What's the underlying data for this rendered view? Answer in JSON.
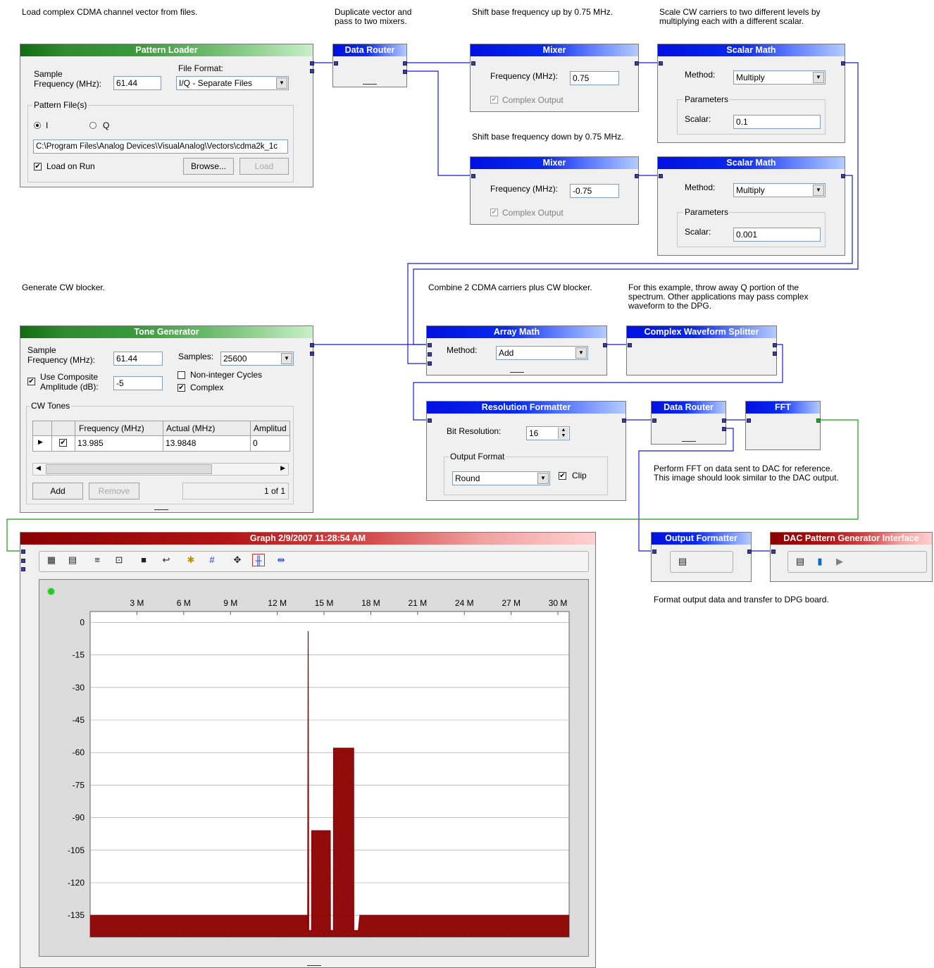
{
  "notes": {
    "load": "Load complex CDMA channel vector from files.",
    "duplicate": "Duplicate vector and\npass to two mixers.",
    "shift_up": "Shift base frequency up by 0.75 MHz.",
    "scale": "Scale CW carriers to two different levels by\nmultiplying each with a different scalar.",
    "shift_down": "Shift base frequency down by 0.75 MHz.",
    "generate_cw": "Generate CW blocker.",
    "combine": "Combine 2 CDMA carriers plus CW blocker.",
    "throw_away": "For this example, throw away Q portion of the\nspectrum.  Other applications may pass complex\nwaveform to the DPG.",
    "perform_fft": "Perform FFT on data sent to DAC for reference.\nThis image should look similar to the DAC output.",
    "format_output": "Format output data and transfer to DPG board."
  },
  "pattern_loader": {
    "title": "Pattern Loader",
    "sample_freq_label": "Sample\nFrequency (MHz):",
    "sample_freq_value": "61.44",
    "file_format_label": "File Format:",
    "file_format_value": "I/Q - Separate Files",
    "pattern_files_label": "Pattern File(s)",
    "radio_i": "I",
    "radio_q": "Q",
    "path": "C:\\Program Files\\Analog Devices\\VisualAnalog\\Vectors\\cdma2k_1c",
    "load_on_run": "Load on Run",
    "browse": "Browse...",
    "load": "Load"
  },
  "data_router_1": {
    "title": "Data Router"
  },
  "mixer_1": {
    "title": "Mixer",
    "freq_label": "Frequency (MHz):",
    "freq_value": "0.75",
    "complex_output": "Complex Output"
  },
  "mixer_2": {
    "title": "Mixer",
    "freq_label": "Frequency (MHz):",
    "freq_value": "-0.75",
    "complex_output": "Complex Output"
  },
  "scalar_math_1": {
    "title": "Scalar Math",
    "method_label": "Method:",
    "method_value": "Multiply",
    "params_label": "Parameters",
    "scalar_label": "Scalar:",
    "scalar_value": "0.1"
  },
  "scalar_math_2": {
    "title": "Scalar Math",
    "method_label": "Method:",
    "method_value": "Multiply",
    "params_label": "Parameters",
    "scalar_label": "Scalar:",
    "scalar_value": "0.001"
  },
  "tone_generator": {
    "title": "Tone Generator",
    "sample_freq_label": "Sample\nFrequency (MHz):",
    "sample_freq_value": "61.44",
    "samples_label": "Samples:",
    "samples_value": "25600",
    "use_composite": "Use Composite\nAmplitude (dB):",
    "amplitude_value": "-5",
    "non_integer": "Non-integer Cycles",
    "complex": "Complex",
    "cw_tones_label": "CW Tones",
    "columns": [
      "Frequency (MHz)",
      "Actual (MHz)",
      "Amplitud"
    ],
    "row": [
      "13.985",
      "13.9848",
      "0"
    ],
    "add": "Add",
    "remove": "Remove",
    "page": "1 of 1"
  },
  "array_math": {
    "title": "Array Math",
    "method_label": "Method:",
    "method_value": "Add"
  },
  "splitter": {
    "title": "Complex Waveform Splitter"
  },
  "resolution_formatter": {
    "title": "Resolution Formatter",
    "bit_label": "Bit Resolution:",
    "bit_value": "16",
    "output_format_label": "Output Format",
    "output_format_value": "Round",
    "clip": "Clip"
  },
  "data_router_2": {
    "title": "Data Router"
  },
  "fft": {
    "title": "FFT"
  },
  "output_formatter": {
    "title": "Output Formatter"
  },
  "dac_interface": {
    "title": "DAC Pattern Generator Interface"
  },
  "graph": {
    "title": "Graph 2/9/2007 11:28:54 AM",
    "x_ticks": [
      "3 M",
      "6 M",
      "9 M",
      "12 M",
      "15 M",
      "18 M",
      "21 M",
      "24 M",
      "27 M",
      "30 M"
    ],
    "y_ticks": [
      "0",
      "-15",
      "-30",
      "-45",
      "-60",
      "-75",
      "-90",
      "-105",
      "-120",
      "-135"
    ],
    "status_color": "#22cc22",
    "trace_color": "#8b0000",
    "toolbar_icons": [
      "chart-icon",
      "table-icon",
      "list-icon",
      "properties-icon",
      "save-icon",
      "export-icon",
      "marker-icon",
      "grid-icon",
      "zoom-icon",
      "cursor-icon",
      "fit-icon"
    ]
  },
  "chart_data": {
    "type": "line",
    "title": "",
    "xlabel": "",
    "ylabel": "",
    "xlim": [
      0,
      30.72
    ],
    "ylim": [
      -145,
      5
    ],
    "x_ticks": [
      3,
      6,
      9,
      12,
      15,
      18,
      21,
      24,
      27,
      30
    ],
    "y_ticks": [
      0,
      -15,
      -30,
      -45,
      -60,
      -75,
      -90,
      -105,
      -120,
      -135
    ],
    "series": [
      {
        "points": [
          [
            0,
            -135
          ],
          [
            13.9,
            -135
          ],
          [
            13.95,
            -142
          ],
          [
            13.98,
            -4
          ],
          [
            14.02,
            -142
          ],
          [
            14.1,
            -142
          ],
          [
            14.2,
            -142
          ],
          [
            14.21,
            -96
          ],
          [
            14.5,
            -96
          ],
          [
            14.8,
            -96
          ],
          [
            15.4,
            -96
          ],
          [
            15.41,
            -142
          ],
          [
            15.6,
            -142
          ],
          [
            15.61,
            -58
          ],
          [
            16.0,
            -58
          ],
          [
            16.5,
            -58
          ],
          [
            16.9,
            -58
          ],
          [
            16.91,
            -142
          ],
          [
            17.2,
            -142
          ],
          [
            17.3,
            -135
          ],
          [
            30.72,
            -135
          ]
        ]
      }
    ]
  }
}
